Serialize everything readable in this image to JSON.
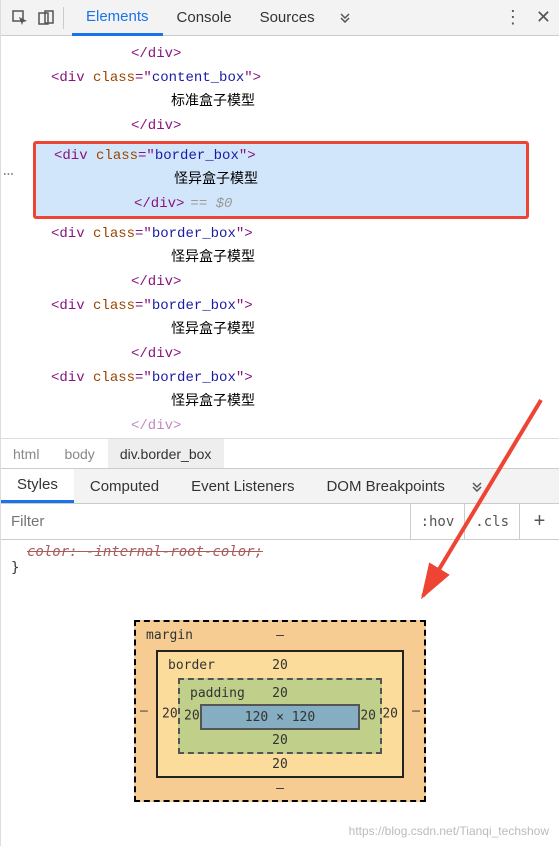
{
  "toolbar": {
    "tabs": [
      "Elements",
      "Console",
      "Sources"
    ],
    "active": 0
  },
  "dom": {
    "close_div": "</div>",
    "content_open": "<div class=\"content_box\">",
    "content_text": "标准盒子模型",
    "border_open": "<div class=\"border_box\">",
    "border_text": "怪异盒子模型",
    "eq": "== $0"
  },
  "breadcrumb": [
    "html",
    "body",
    "div.border_box"
  ],
  "lower_tabs": [
    "Styles",
    "Computed",
    "Event Listeners",
    "DOM Breakpoints"
  ],
  "filter": {
    "placeholder": "Filter",
    "hov": ":hov",
    "cls": ".cls"
  },
  "styles": {
    "strike": "color: -internal-root-color;",
    "brace": "}"
  },
  "box_model": {
    "margin_label": "margin",
    "border_label": "border",
    "padding_label": "padding",
    "dash": "–",
    "v20": "20",
    "content": "120 × 120"
  },
  "watermark": "https://blog.csdn.net/Tianqi_techshow"
}
